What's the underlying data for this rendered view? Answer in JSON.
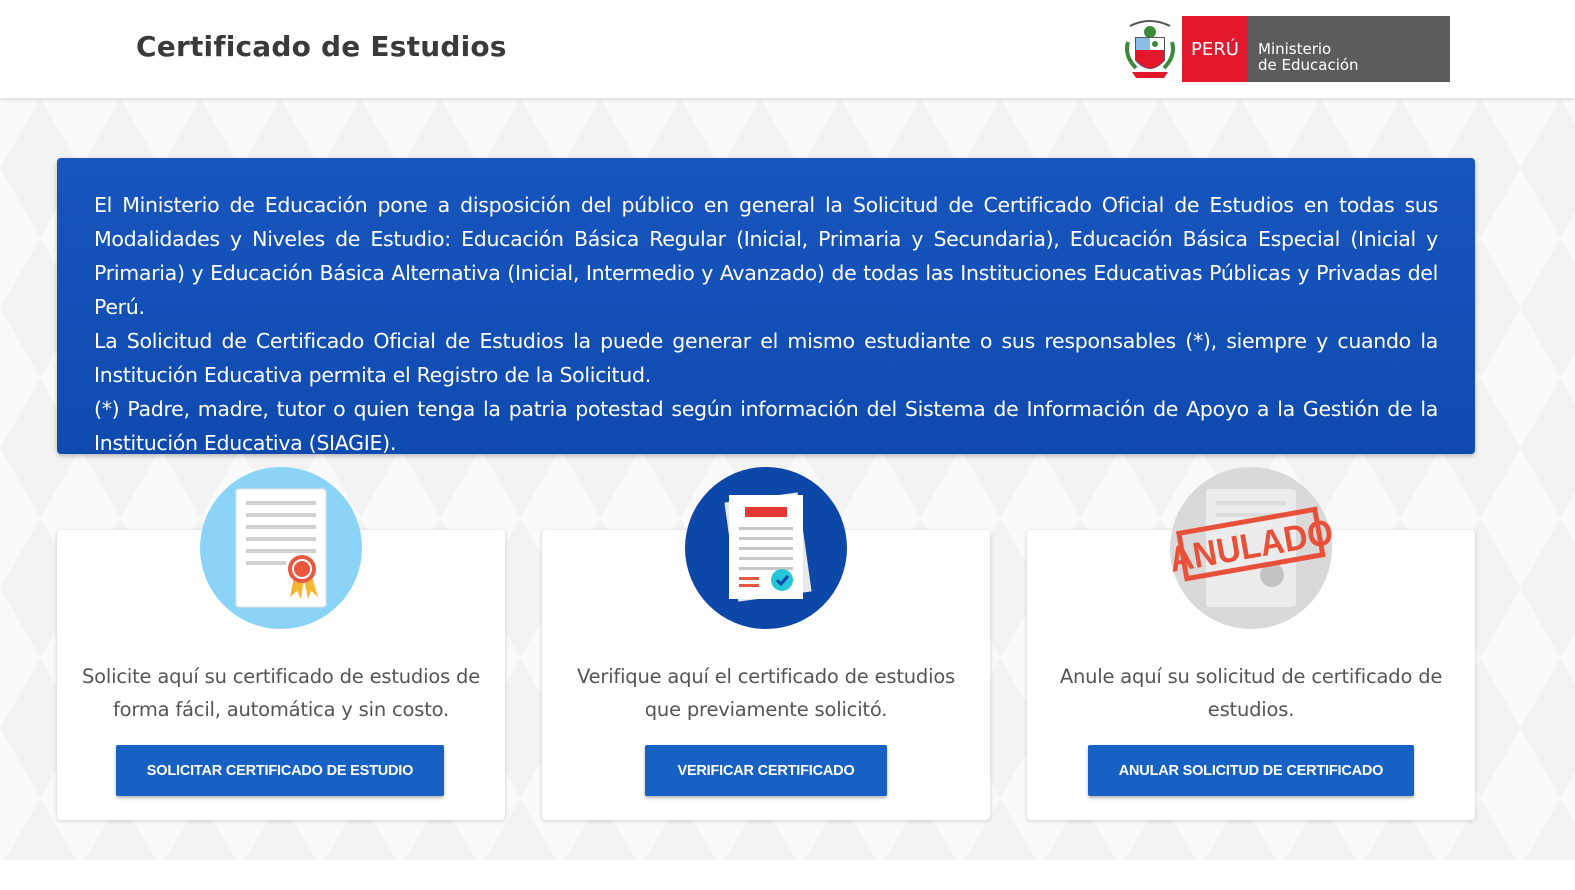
{
  "header": {
    "title": "Certificado de Estudios",
    "logo": {
      "peru_label": "PERÚ",
      "ministry_line1": "Ministerio",
      "ministry_line2": "de Educación",
      "brand_red": "#e3182d",
      "brand_gray": "#5c5c5c"
    }
  },
  "banner": {
    "paragraph1": "El Ministerio de Educación pone a disposición del público en general la Solicitud de Certificado Oficial de Estudios en todas sus Modalidades y Niveles de Estudio: Educación Básica Regular (Inicial, Primaria y Secundaria), Educación Básica Especial (Inicial y Primaria) y Educación Básica Alternativa (Inicial, Intermedio y Avanzado) de todas las Instituciones Educativas Públicas y Privadas del Perú.",
    "paragraph2": "La Solicitud de Certificado Oficial de Estudios la puede generar el mismo estudiante o sus responsables (*), siempre y cuando la Institución Educativa permita el Registro de la Solicitud.",
    "paragraph3": "(*) Padre, madre, tutor o quien tenga la patria potestad según información del Sistema de Información de Apoyo a la Gestión de la Institución Educativa (SIAGIE).",
    "color": "#1756bf"
  },
  "cards": [
    {
      "icon": "certificate-icon",
      "text": "Solicite aquí su certificado de estudios de forma fácil, automática y sin costo.",
      "button": "SOLICITAR CERTIFICADO DE ESTUDIO"
    },
    {
      "icon": "verify-document-icon",
      "text": "Verifique aquí el certificado de estudios que previamente solicitó.",
      "button": "VERIFICAR CERTIFICADO"
    },
    {
      "icon": "cancelled-certificate-icon",
      "stamp": "ANULADO",
      "text": "Anule aquí su solicitud de certificado de estudios.",
      "button": "ANULAR SOLICITUD DE CERTIFICADO"
    }
  ],
  "colors": {
    "button": "#1760c4",
    "icon1_bg": "#8bd4f7",
    "icon2_bg": "#0d47a8",
    "icon3_bg": "#d9d9d9",
    "stamp": "#e8503a"
  }
}
